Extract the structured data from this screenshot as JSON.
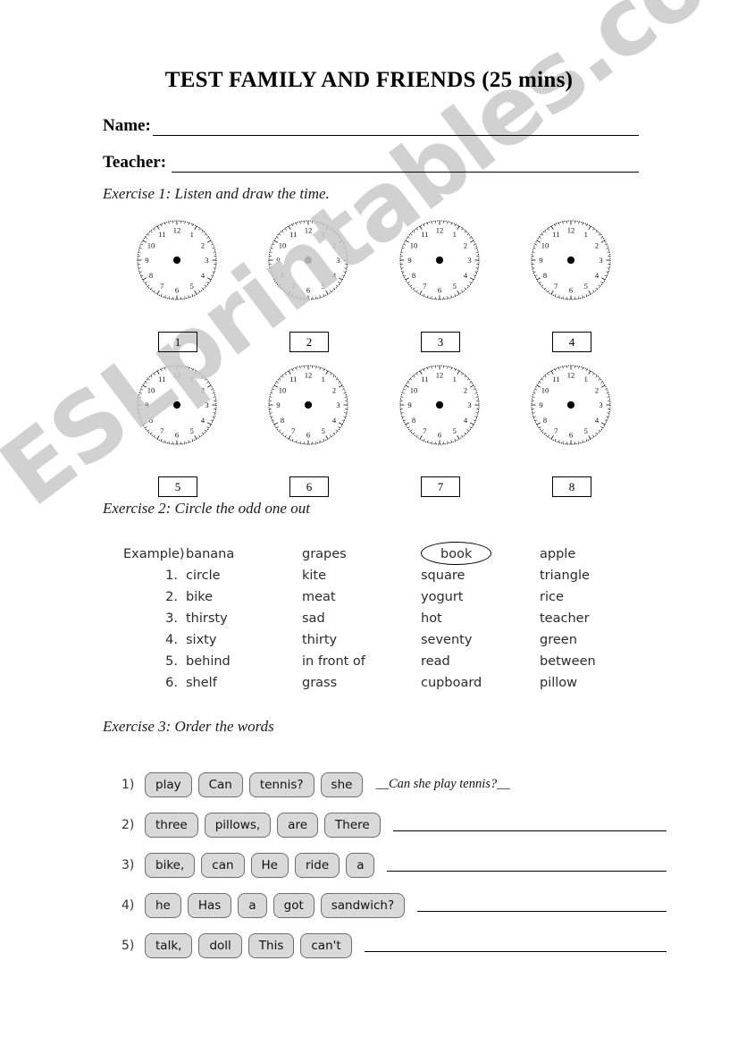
{
  "document": {
    "title": "TEST FAMILY AND  FRIENDS (25 mins)",
    "watermark": "ESLprintables.com",
    "watermark_color": "#c9c9c9"
  },
  "fields": {
    "name_label": "Name:",
    "teacher_label": "Teacher:"
  },
  "exercise1": {
    "heading": "Exercise 1: Listen and draw the time.",
    "clock_numerals": [
      "12",
      "1",
      "2",
      "3",
      "4",
      "5",
      "6",
      "7",
      "8",
      "9",
      "10",
      "11"
    ],
    "labels_row1": [
      "1",
      "2",
      "3",
      "4"
    ],
    "labels_row2": [
      "5",
      "6",
      "7",
      "8"
    ]
  },
  "exercise2": {
    "heading": "Exercise 2: Circle the odd one out",
    "rows": [
      {
        "index": "Example)",
        "words": [
          "banana",
          "grapes",
          "book",
          "apple"
        ],
        "circled": 2
      },
      {
        "index": "1.",
        "words": [
          "circle",
          "kite",
          "square",
          "triangle"
        ],
        "circled": -1
      },
      {
        "index": "2.",
        "words": [
          "bike",
          "meat",
          "yogurt",
          "rice"
        ],
        "circled": -1
      },
      {
        "index": "3.",
        "words": [
          "thirsty",
          "sad",
          "hot",
          "teacher"
        ],
        "circled": -1
      },
      {
        "index": "4.",
        "words": [
          "sixty",
          "thirty",
          "seventy",
          "green"
        ],
        "circled": -1
      },
      {
        "index": "5.",
        "words": [
          "behind",
          "in front of",
          "read",
          "between"
        ],
        "circled": -1
      },
      {
        "index": "6.",
        "words": [
          "shelf",
          "grass",
          "cupboard",
          "pillow"
        ],
        "circled": -1
      }
    ]
  },
  "exercise3": {
    "heading": "Exercise 3: Order the words",
    "rows": [
      {
        "num": "1)",
        "tiles": [
          "play",
          "Can",
          "tennis?",
          "she"
        ],
        "answer": "__Can she play tennis?__"
      },
      {
        "num": "2)",
        "tiles": [
          "three",
          "pillows,",
          "are",
          "There"
        ],
        "answer": ""
      },
      {
        "num": "3)",
        "tiles": [
          "bike,",
          "can",
          "He",
          "ride",
          "a"
        ],
        "answer": ""
      },
      {
        "num": "4)",
        "tiles": [
          "he",
          "Has",
          "a",
          "got",
          "sandwich?"
        ],
        "answer": ""
      },
      {
        "num": "5)",
        "tiles": [
          "talk,",
          "doll",
          "This",
          "can't"
        ],
        "answer": ""
      }
    ]
  }
}
